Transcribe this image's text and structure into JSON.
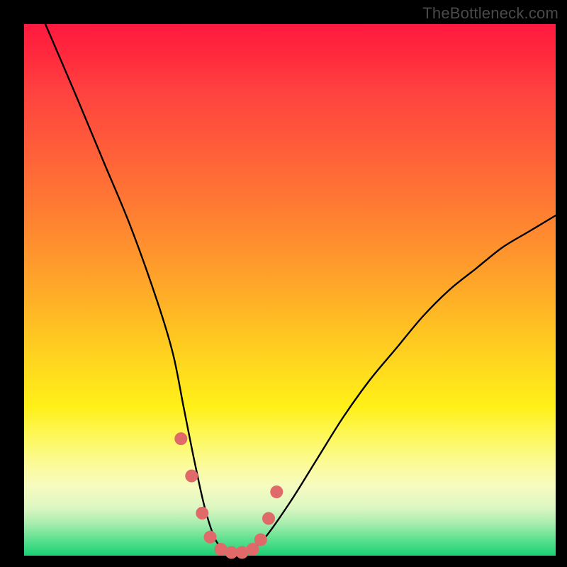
{
  "watermark": "TheBottleneck.com",
  "chart_data": {
    "type": "line",
    "title": "",
    "xlabel": "",
    "ylabel": "",
    "xlim": [
      0,
      100
    ],
    "ylim": [
      0,
      100
    ],
    "grid": false,
    "legend": false,
    "series": [
      {
        "name": "bottleneck-curve",
        "color": "#000000",
        "x": [
          4,
          10,
          15,
          20,
          25,
          28,
          30,
          32,
          34,
          36,
          38,
          40,
          42,
          45,
          50,
          55,
          60,
          65,
          70,
          75,
          80,
          85,
          90,
          95,
          100
        ],
        "y": [
          100,
          86,
          74,
          62,
          48,
          38,
          28,
          18,
          9,
          3,
          1,
          0.5,
          1,
          3,
          10,
          18,
          26,
          33,
          39,
          45,
          50,
          54,
          58,
          61,
          64
        ]
      },
      {
        "name": "highlight-dots",
        "color": "#e06a6a",
        "x": [
          29.5,
          31.5,
          33.5,
          35.0,
          37.0,
          39.0,
          41.0,
          43.0,
          44.5,
          46.0,
          47.5
        ],
        "y": [
          22,
          15,
          8,
          3.5,
          1.2,
          0.6,
          0.6,
          1.2,
          3.0,
          7.0,
          12.0
        ]
      }
    ],
    "background_gradient": {
      "top": "#ff1a3f",
      "mid": "#ffd81e",
      "bottom": "#18d074"
    }
  }
}
